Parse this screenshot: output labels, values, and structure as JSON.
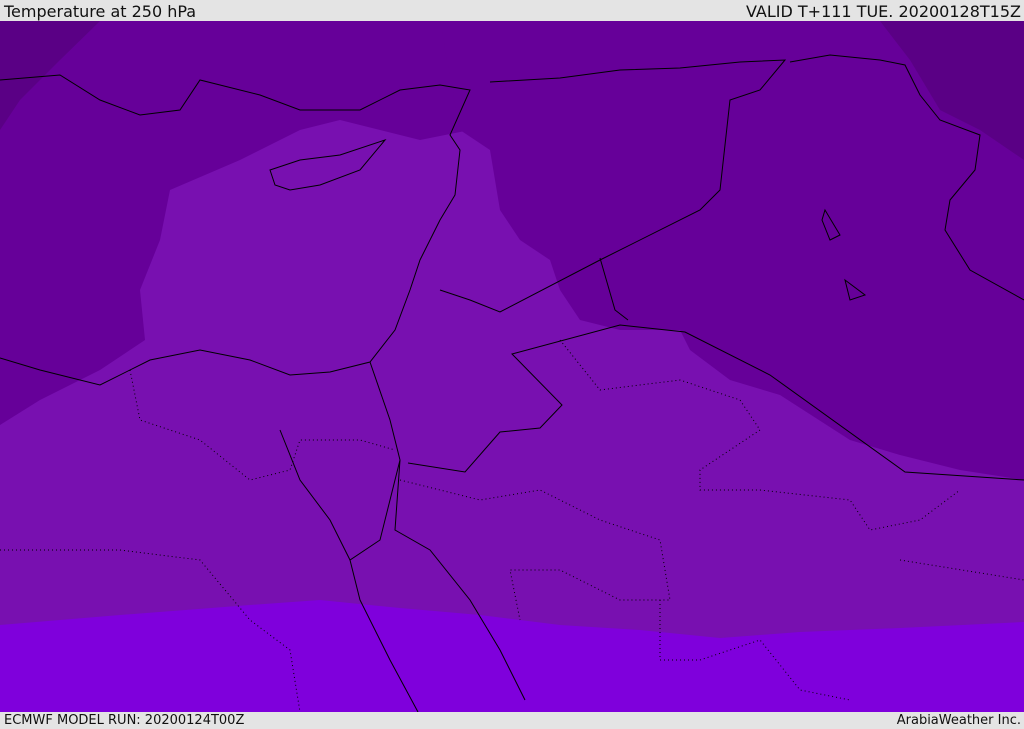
{
  "header": {
    "title": "Temperature at 250 hPa",
    "valid": "VALID T+111 TUE. 20200128T15Z"
  },
  "footer": {
    "model_run": "ECMWF MODEL RUN: 20200124T00Z",
    "credit": "ArabiaWeather Inc."
  },
  "colors": {
    "darkest": "#5a0085",
    "dark": "#660099",
    "mid": "#7810b0",
    "bright": "#7f00dc"
  }
}
